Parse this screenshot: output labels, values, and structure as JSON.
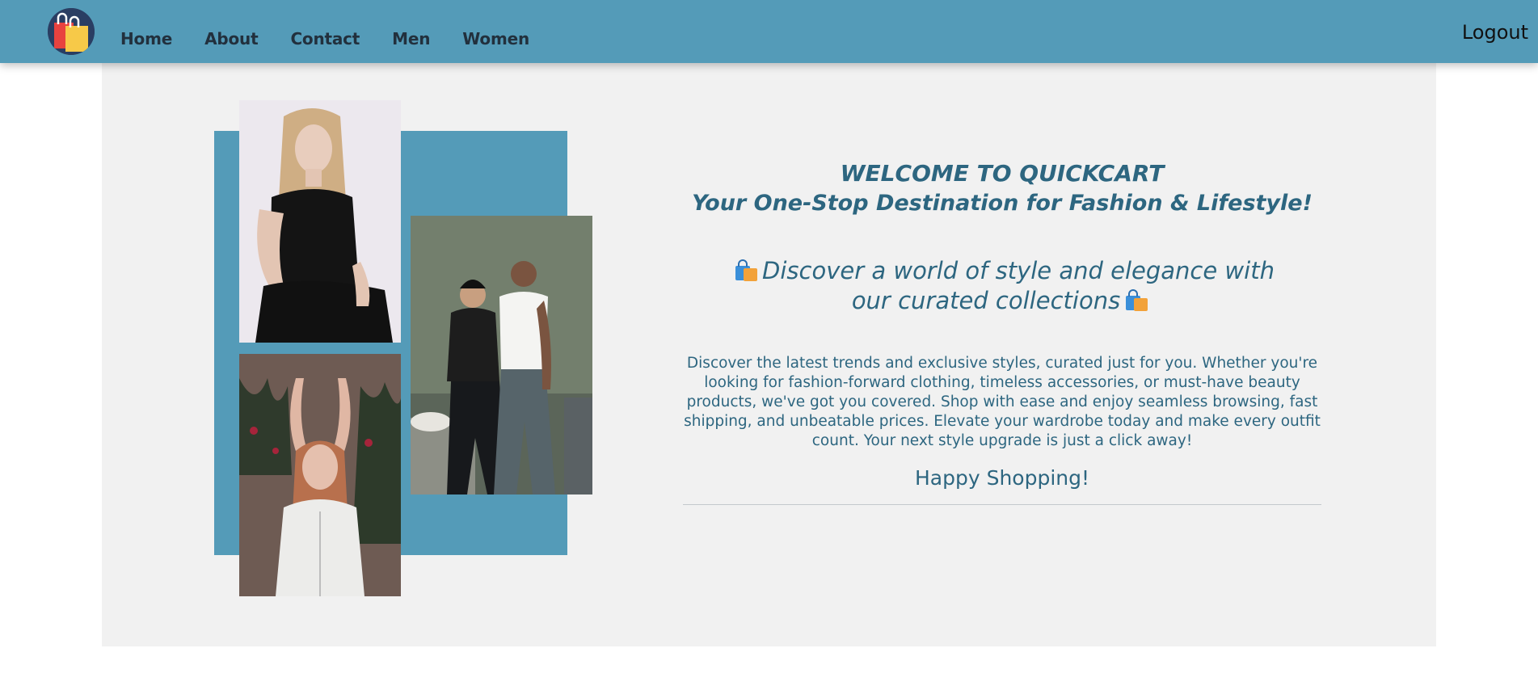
{
  "nav": {
    "logo_icon": "shopping-bags-logo-icon",
    "links": [
      "Home",
      "About",
      "Contact",
      "Men",
      "Women"
    ],
    "logout_label": "Logout"
  },
  "colors": {
    "navbar": "#549bb8",
    "panel": "#f1f1f1",
    "accent_text": "#2d6680",
    "photo_frame": "#549bb8"
  },
  "hero": {
    "title": "WELCOME TO QUICKCART",
    "subtitle": "Your One-Stop Destination for Fashion & Lifestyle!",
    "tagline": "Discover a world of style and elegance with our curated collections",
    "tagline_icon": "shopping-bags-icon",
    "description": "Discover the latest trends and exclusive styles, curated just for you. Whether you're looking for fashion-forward clothing, timeless accessories, or must-have beauty products, we've got you covered. Shop with ease and enjoy seamless browsing, fast shipping, and unbeatable prices. Elevate your wardrobe today and make every outfit count. Your next style upgrade is just a click away!",
    "closing": "Happy Shopping!"
  }
}
